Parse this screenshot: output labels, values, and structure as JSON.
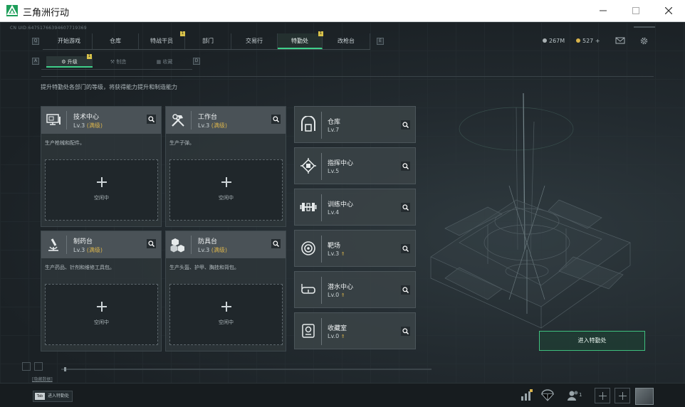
{
  "window": {
    "title": "三角洲行动"
  },
  "header": {
    "uid": "CN UID:6475176639460771936​9",
    "tabs": [
      {
        "label": "开始游戏",
        "badge": ""
      },
      {
        "label": "仓库",
        "badge": ""
      },
      {
        "label": "特战干员",
        "badge": "1"
      },
      {
        "label": "部门",
        "badge": ""
      },
      {
        "label": "交易行",
        "badge": ""
      },
      {
        "label": "特勤处",
        "badge": "1",
        "active": true
      },
      {
        "label": "改枪台",
        "badge": ""
      }
    ],
    "nav_keys": {
      "left": "Q",
      "right": "E"
    },
    "currency": [
      {
        "value": "267M"
      },
      {
        "value": "527 +"
      }
    ]
  },
  "subtabs": {
    "keys": {
      "left": "A",
      "right": "D"
    },
    "items": [
      {
        "label": "升级",
        "badge": "1",
        "active": true
      },
      {
        "label": "制造"
      },
      {
        "label": "收藏"
      }
    ]
  },
  "description": "提升特勤处各部门的等级，将获得能力提升和制造能力",
  "production_cards": [
    {
      "name": "技术中心",
      "level": "Lv.3",
      "status": "(满级)",
      "desc": "生产枪械和配件。",
      "slot": "空闲中",
      "icon": "computer-icon"
    },
    {
      "name": "工作台",
      "level": "Lv.3",
      "status": "(满级)",
      "desc": "生产子弹。",
      "slot": "空闲中",
      "icon": "hammer-wrench-icon"
    },
    {
      "name": "制药台",
      "level": "Lv.3",
      "status": "(满级)",
      "desc": "生产药品、针剂和维修工具包。",
      "slot": "空闲中",
      "icon": "microscope-icon"
    },
    {
      "name": "防具台",
      "level": "Lv.3",
      "status": "(满级)",
      "desc": "生产头盔、护甲、胸挂和背包。",
      "slot": "空闲中",
      "icon": "cubes-icon"
    }
  ],
  "facility_cards": [
    {
      "name": "仓库",
      "level": "Lv.7",
      "upgradable": false,
      "icon": "warehouse-icon"
    },
    {
      "name": "指挥中心",
      "level": "Lv.5",
      "upgradable": false,
      "icon": "chip-icon"
    },
    {
      "name": "训练中心",
      "level": "Lv.4",
      "upgradable": false,
      "icon": "dumbbell-icon"
    },
    {
      "name": "靶场",
      "level": "Lv.3",
      "upgradable": true,
      "icon": "target-icon"
    },
    {
      "name": "潜水中心",
      "level": "Lv.0",
      "upgradable": true,
      "icon": "diving-mask-icon"
    },
    {
      "name": "收藏室",
      "level": "Lv.0",
      "upgradable": true,
      "icon": "trophy-icon"
    }
  ],
  "enter_button": "进入特勤处",
  "bottom": {
    "link": "[隐藏数据]",
    "hint_key": "Tab",
    "hint_label": "进入特勤处",
    "friends_count": "1"
  },
  "colors": {
    "accent": "#3fd08a",
    "gold": "#d9b34c",
    "card_head": "#4a5257"
  }
}
